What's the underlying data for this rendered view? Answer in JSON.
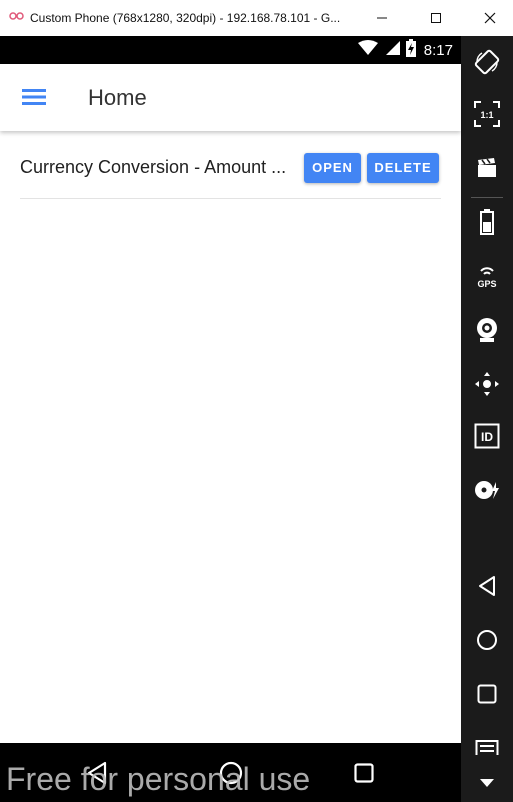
{
  "window": {
    "title": "Custom Phone (768x1280, 320dpi) - 192.168.78.101 - G...",
    "controls": {
      "minimize": "minimize",
      "maximize": "maximize",
      "close": "close"
    }
  },
  "status_bar": {
    "time": "8:17",
    "icons": [
      "wifi-icon",
      "signal-icon",
      "battery-charging-icon"
    ]
  },
  "app_bar": {
    "menu_icon": "hamburger-menu-icon",
    "title": "Home"
  },
  "list": {
    "items": [
      {
        "label": "Currency Conversion - Amount ...",
        "open_label": "OPEN",
        "delete_label": "DELETE"
      }
    ]
  },
  "android_nav": {
    "buttons": [
      "back-icon",
      "home-icon",
      "recent-apps-icon"
    ]
  },
  "watermark": {
    "text": "Free for personal use"
  },
  "emulator_toolbar": {
    "buttons": [
      "rotate-icon",
      "pixel-perfect-icon",
      "screencast-icon",
      "battery-icon",
      "gps-icon",
      "camera-icon",
      "move-icon",
      "identifier-icon",
      "disk-icon",
      "back-icon",
      "home-icon",
      "overview-icon",
      "menu-icon",
      "chevron-down-icon"
    ],
    "gps_label": "GPS",
    "pixel_perfect_label": "1:1",
    "id_label": "ID"
  },
  "colors": {
    "accent": "#4285f4",
    "menu_icon": "#4285f4",
    "status_bar": "#000000",
    "toolbar": "#1b1b1b"
  }
}
